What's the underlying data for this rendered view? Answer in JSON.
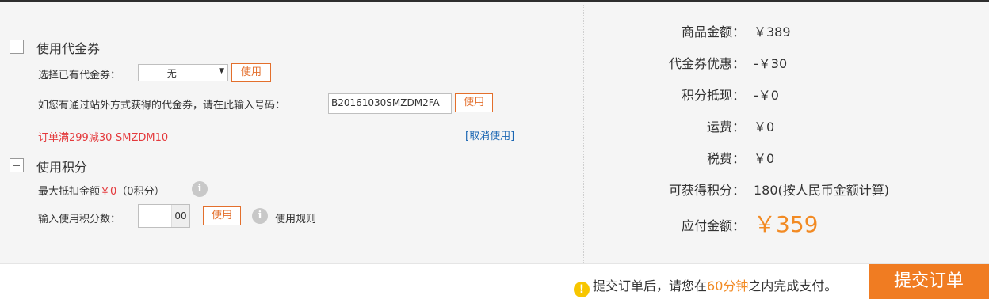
{
  "coupon_section": {
    "title": "使用代金券",
    "select_label": "选择已有代金券：",
    "select_value": "------ 无 ------",
    "use_button": "使用",
    "code_label": "如您有通过站外方式获得的代金券，请在此输入号码：",
    "code_value": "B20161030SMZDM2FA",
    "code_use_button": "使用",
    "applied_coupon": "订单满299减30-SMZDM10",
    "cancel_link": "[取消使用]"
  },
  "points_section": {
    "title": "使用积分",
    "max_deduct_label": "最大抵扣金额",
    "max_deduct_value": "￥0",
    "max_deduct_points": "（0积分）",
    "input_label": "输入使用积分数：",
    "input_suffix": "00",
    "use_button": "使用",
    "rules_link": "使用规则"
  },
  "summary": {
    "goods_label": "商品金额：",
    "goods_value": "￥389",
    "coupon_label": "代金券优惠：",
    "coupon_value": "-￥30",
    "points_label": "积分抵现：",
    "points_value": "-￥0",
    "shipping_label": "运费：",
    "shipping_value": "￥0",
    "tax_label": "税费：",
    "tax_value": "￥0",
    "earn_label": "可获得积分：",
    "earn_value": "180(按人民币金额计算)",
    "total_label": "应付金额：",
    "total_value": "￥359"
  },
  "footer": {
    "notice_prefix": "提交订单后，请您在",
    "notice_time": "60分钟",
    "notice_suffix": "之内完成支付。",
    "submit_button": "提交订单"
  },
  "colors": {
    "accent": "#f07c22",
    "coupon_red": "#e4393c",
    "link_blue": "#1a66b3"
  }
}
